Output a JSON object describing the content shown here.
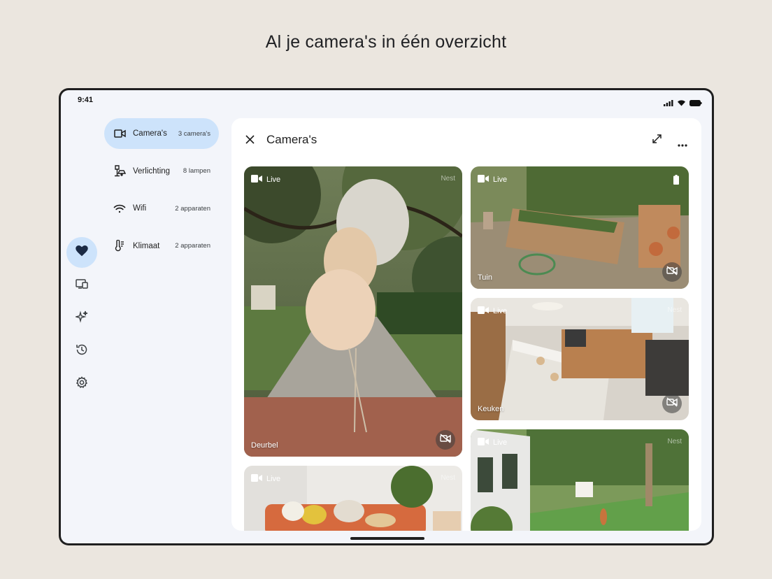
{
  "headline": "Al je camera's in één overzicht",
  "status": {
    "time": "9:41"
  },
  "rail": {
    "items": [
      {
        "icon": "heart-icon",
        "active": true
      },
      {
        "icon": "devices-icon",
        "active": false
      },
      {
        "icon": "sparkle-icon",
        "active": false
      },
      {
        "icon": "history-icon",
        "active": false
      },
      {
        "icon": "gear-icon",
        "active": false
      }
    ]
  },
  "nav": {
    "items": [
      {
        "label": "Camera's",
        "sub": "3 camera's",
        "icon": "camera-icon",
        "active": true
      },
      {
        "label": "Verlichting",
        "sub": "8 lampen",
        "icon": "lamp-icon",
        "active": false
      },
      {
        "label": "Wifi",
        "sub": "2 apparaten",
        "icon": "wifi-icon",
        "active": false
      },
      {
        "label": "Klimaat",
        "sub": "2 apparaten",
        "icon": "thermometer-icon",
        "active": false
      }
    ]
  },
  "panel": {
    "title": "Camera's",
    "cameras": [
      {
        "name": "Deurbel",
        "live": "Live",
        "watermark": "Nest"
      },
      {
        "name": "Tuin",
        "live": "Live",
        "watermark": ""
      },
      {
        "name": "Keuken",
        "live": "Live",
        "watermark": "Nest"
      },
      {
        "name": "",
        "live": "Live",
        "watermark": "Nest"
      },
      {
        "name": "",
        "live": "Live",
        "watermark": "Nest"
      }
    ]
  },
  "colors": {
    "accent": "#cde3fb",
    "background": "#ebe6df",
    "screen": "#f3f5fa"
  }
}
